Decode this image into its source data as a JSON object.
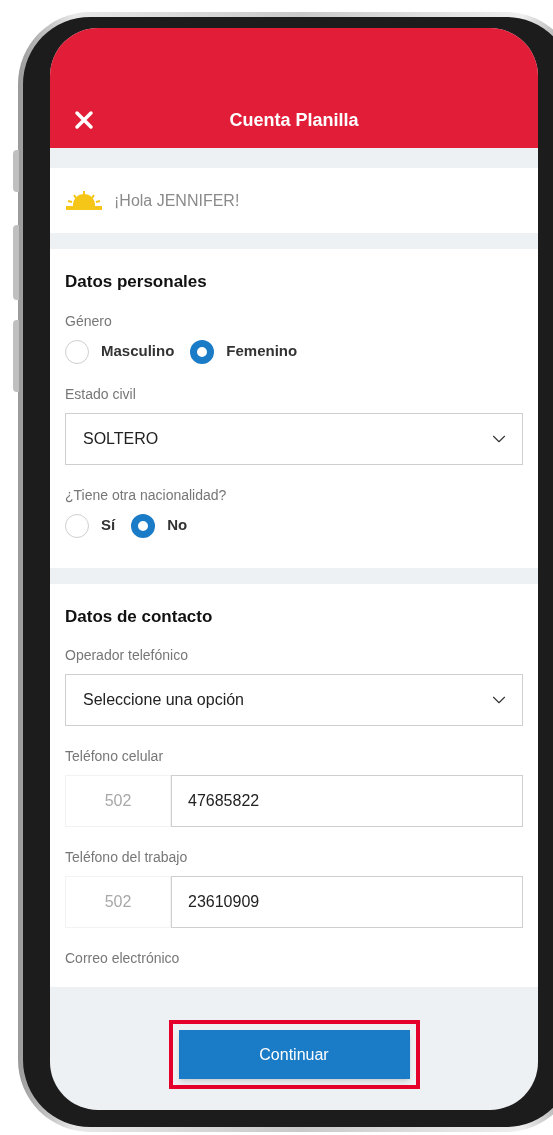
{
  "header": {
    "title": "Cuenta Planilla"
  },
  "greeting": {
    "text": "¡Hola JENNIFER!"
  },
  "sections": [
    {
      "title": "Datos personales",
      "fields": [
        {
          "kind": "radio",
          "label": "Género",
          "options": [
            {
              "label": "Masculino",
              "selected": false
            },
            {
              "label": "Femenino",
              "selected": true
            }
          ]
        },
        {
          "kind": "select",
          "label": "Estado civil",
          "value": "SOLTERO"
        },
        {
          "kind": "radio",
          "label": "¿Tiene otra nacionalidad?",
          "options": [
            {
              "label": "Sí",
              "selected": false
            },
            {
              "label": "No",
              "selected": true
            }
          ]
        }
      ]
    },
    {
      "title": "Datos de contacto",
      "fields": [
        {
          "kind": "select",
          "label": "Operador telefónico",
          "value": "Seleccione una opción"
        },
        {
          "kind": "phone",
          "label": "Teléfono celular",
          "prefix": "502",
          "value": "47685822"
        },
        {
          "kind": "phone",
          "label": "Teléfono del trabajo",
          "prefix": "502",
          "value": "23610909"
        },
        {
          "kind": "label",
          "label": "Correo electrónico"
        }
      ]
    }
  ],
  "footer": {
    "button": "Continuar",
    "highlighted": true
  }
}
